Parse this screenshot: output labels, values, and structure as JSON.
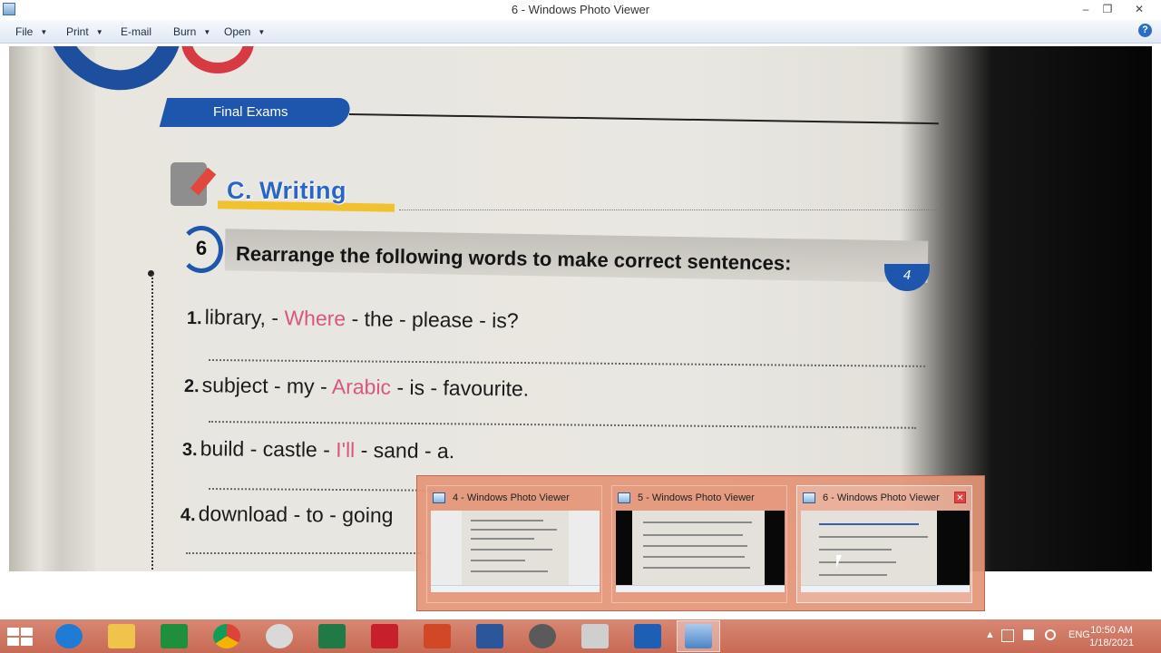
{
  "window": {
    "title": "6 - Windows Photo Viewer",
    "min_glyph": "–",
    "restore_glyph": "❐",
    "close_glyph": "✕"
  },
  "menu": {
    "file": "File",
    "print": "Print",
    "email": "E-mail",
    "burn": "Burn",
    "open": "Open",
    "dropdown_glyph": "▼",
    "help_glyph": "?"
  },
  "photo": {
    "ribbon_label": "Final Exams",
    "section_title": "C. Writing",
    "question_number": "6",
    "instruction": "Rearrange the following words to make correct sentences:",
    "score": "4",
    "sentences": [
      {
        "num": "1.",
        "before": "library, - ",
        "highlight": "Where",
        "after": " - the - please - is?"
      },
      {
        "num": "2.",
        "before": "subject - my - ",
        "highlight": "Arabic",
        "after": " - is - favourite."
      },
      {
        "num": "3.",
        "before": "build - castle - ",
        "highlight": "I'll",
        "after": " - sand - a."
      },
      {
        "num": "4.",
        "before": "download - to - going",
        "highlight": "",
        "after": ""
      }
    ]
  },
  "thumbnails": [
    {
      "title": "4 - Windows Photo Viewer",
      "active": false
    },
    {
      "title": "5 - Windows Photo Viewer",
      "active": false
    },
    {
      "title": "6 - Windows Photo Viewer",
      "active": true,
      "close_glyph": "✕"
    }
  ],
  "taskbar": {
    "apps": [
      "start-icon",
      "internet-explorer-icon",
      "file-explorer-icon",
      "store-icon",
      "chrome-icon",
      "paint-icon",
      "excel-icon",
      "acrobat-icon",
      "powerpoint-icon",
      "word-icon",
      "microphone-icon",
      "printer-icon",
      "pen-tool-icon",
      "photo-viewer-icon"
    ],
    "tray_arrow": "▲",
    "language": "ENG",
    "time": "10:50 AM",
    "date": "1/18/2021"
  },
  "colors": {
    "accent_blue": "#1e56ae",
    "highlight_pink": "#d9577f",
    "writing_yellow": "#f2c12e",
    "taskbar": "#c76a55"
  }
}
